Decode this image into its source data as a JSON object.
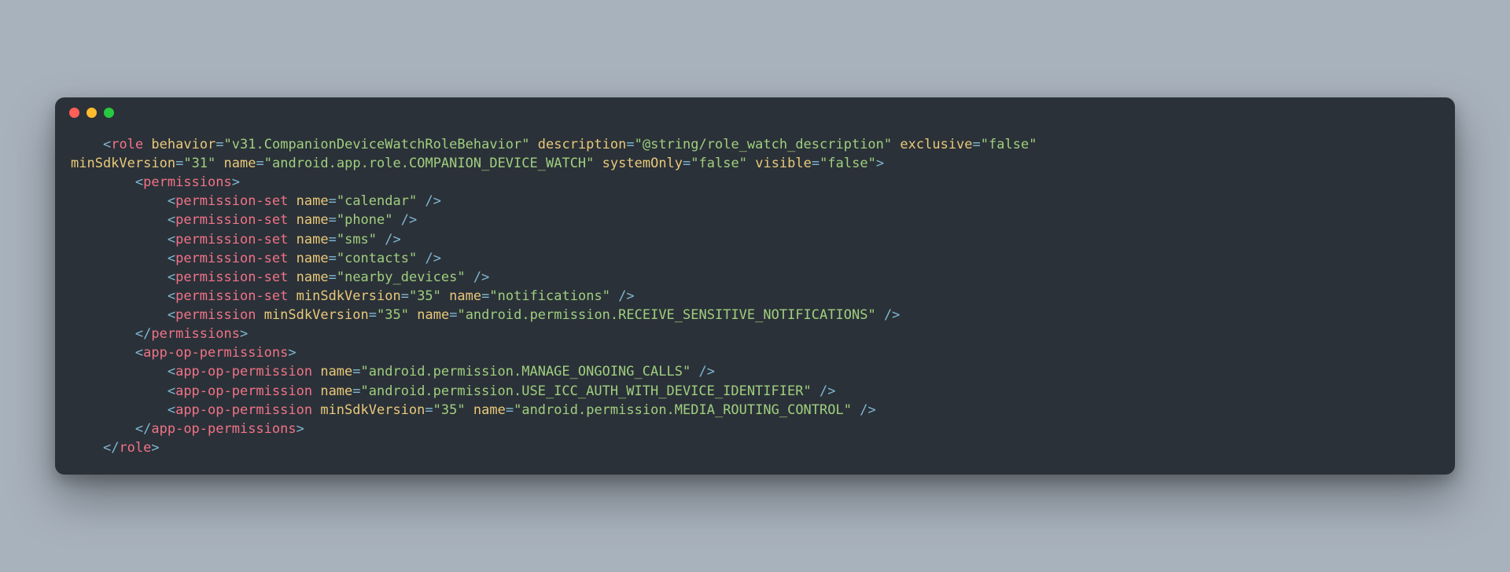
{
  "window": {
    "traffic_lights": [
      "close",
      "minimize",
      "zoom"
    ]
  },
  "code": {
    "indent_open_role": "    ",
    "indent_wrap": "",
    "indent_l1": "        ",
    "indent_l2": "            ",
    "role": {
      "tag": "role",
      "attrs": {
        "behavior": "v31.CompanionDeviceWatchRoleBehavior",
        "description": "@string/role_watch_description",
        "exclusive": "false",
        "minSdkVersion": "31",
        "name": "android.app.role.COMPANION_DEVICE_WATCH",
        "systemOnly": "false",
        "visible": "false"
      }
    },
    "permissions_tag": "permissions",
    "permission_set_tag": "permission-set",
    "permission_tag": "permission",
    "app_op_perms_tag": "app-op-permissions",
    "app_op_perm_tag": "app-op-permission",
    "attr_name": "name",
    "attr_minsdk": "minSdkVersion",
    "perm_sets": {
      "calendar": "calendar",
      "phone": "phone",
      "sms": "sms",
      "contacts": "contacts",
      "nearby_devices": "nearby_devices",
      "notifications": "notifications",
      "notif_minsdk": "35"
    },
    "permission": {
      "minsdk": "35",
      "name": "android.permission.RECEIVE_SENSITIVE_NOTIFICATIONS"
    },
    "app_ops": {
      "manage_calls": "android.permission.MANAGE_ONGOING_CALLS",
      "icc_auth": "android.permission.USE_ICC_AUTH_WITH_DEVICE_IDENTIFIER",
      "media_route": "android.permission.MEDIA_ROUTING_CONTROL",
      "media_minsdk": "35"
    }
  }
}
